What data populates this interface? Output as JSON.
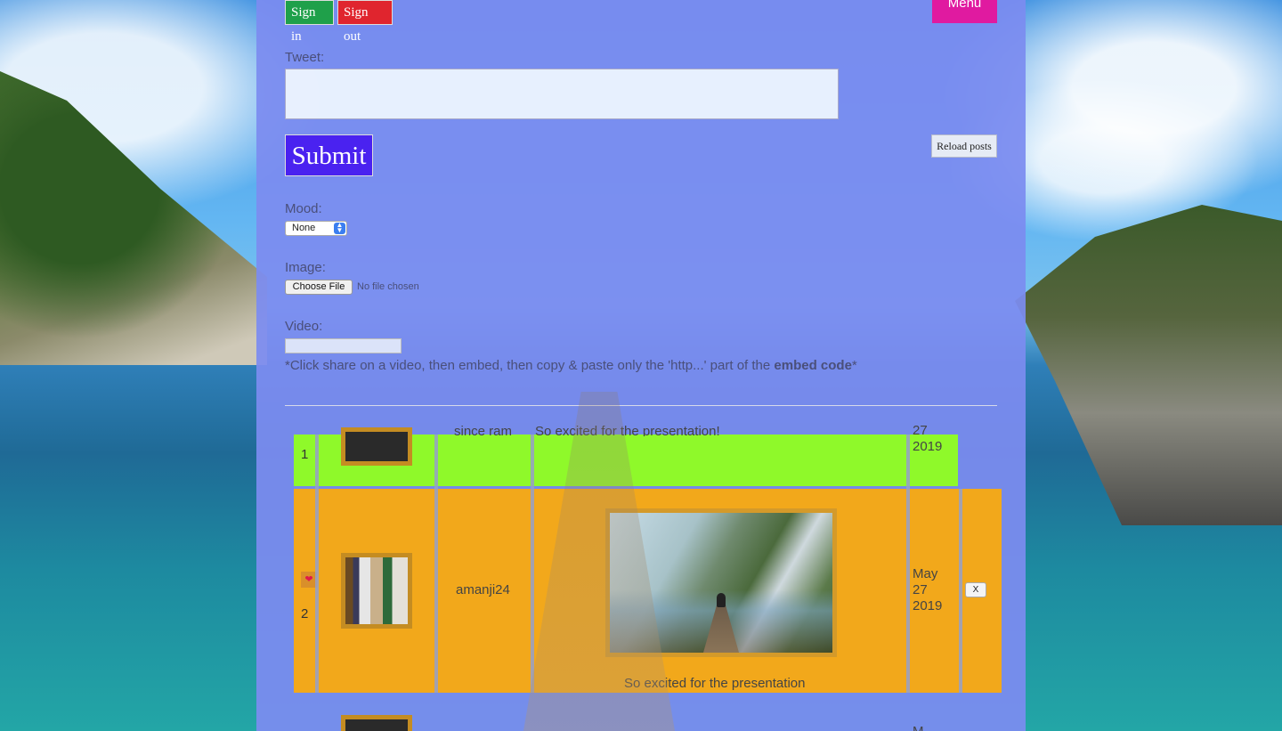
{
  "header": {
    "sign_in": "Sign in",
    "sign_out": "Sign out",
    "menu": "Menu"
  },
  "compose": {
    "tweet_label": "Tweet:",
    "tweet_value": "",
    "submit": "Submit",
    "reload": "Reload posts",
    "mood_label": "Mood:",
    "mood_selected": "None",
    "image_label": "Image:",
    "choose_file": "Choose File",
    "no_file": "No file chosen",
    "video_label": "Video:",
    "video_value": "",
    "video_note_before": "*Click share on a video, then embed, then copy & paste only the 'http...' part of the ",
    "video_note_bold": "embed code",
    "video_note_after": "*"
  },
  "posts": [
    {
      "number": "1",
      "user_partial": "since ram",
      "text_partial": "So excited for the presentation!",
      "date_partial": "27 2019"
    },
    {
      "number": "2",
      "heart": "❤",
      "user": "amanji24",
      "caption": "So excited for the presentation",
      "date_line1": "May",
      "date_line2": "27",
      "date_line3": "2019",
      "delete": "X"
    },
    {
      "date_partial": "M"
    }
  ],
  "colors": {
    "panel": "#7c8cf0",
    "sign_in": "#1fa04a",
    "sign_out": "#e0252e",
    "menu": "#e01aa0",
    "submit": "#4a22f0",
    "row1": "#8ff92a",
    "row2": "#f2a81b"
  }
}
